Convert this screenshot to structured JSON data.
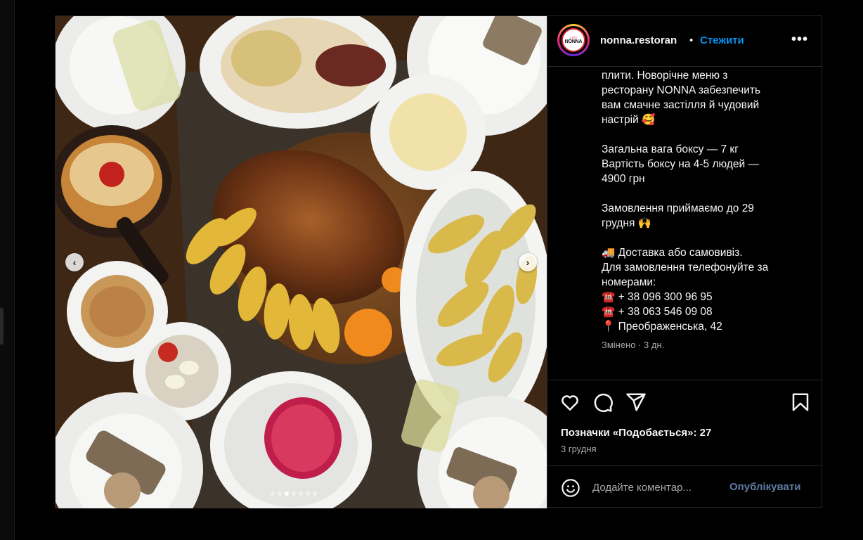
{
  "post": {
    "account": {
      "username": "nonna.restoran",
      "separator": "•",
      "follow_label": "Стежити",
      "avatar_text_top": "CAFE",
      "avatar_text_main": "NONNA",
      "more_label": "•••"
    },
    "media": {
      "prev_label": "‹",
      "next_label": "›",
      "slide_count": 7,
      "active_slide": 3,
      "photo_description_icon": "food-table-photo"
    },
    "caption": {
      "lines": [
        "плити. Новорічне меню з",
        "ресторану NONNA забезпечить",
        "вам смачне застілля й чудовий",
        "настрій 🥰",
        "",
        "Загальна вага боксу — 7 кг",
        "Вартість боксу на 4-5 людей —",
        "4900 грн",
        "",
        "Замовлення приймаємо до 29",
        "грудня 🙌",
        "",
        "🚚 Доставка або самовивіз.",
        "Для замовлення телефонуйте за",
        "номерами:",
        "☎️ + 38 096 300 96 95",
        "☎️ + 38 063 546 09 08",
        "📍 Преображенська, 42"
      ],
      "edited": "Змінено · 3 дн."
    },
    "actions": {
      "icons": [
        "heart-icon",
        "comment-icon",
        "share-icon",
        "bookmark-icon"
      ],
      "likes": "Позначки «Подобається»: 27",
      "date": "3 грудня"
    },
    "comment": {
      "placeholder": "Додайте коментар...",
      "publish_label": "Опублікувати"
    },
    "colors": {
      "background": "#000000",
      "follow": "#0095f6",
      "muted": "#a8a8a8",
      "publish_disabled": "#5f7ca6",
      "border": "#262626"
    }
  }
}
